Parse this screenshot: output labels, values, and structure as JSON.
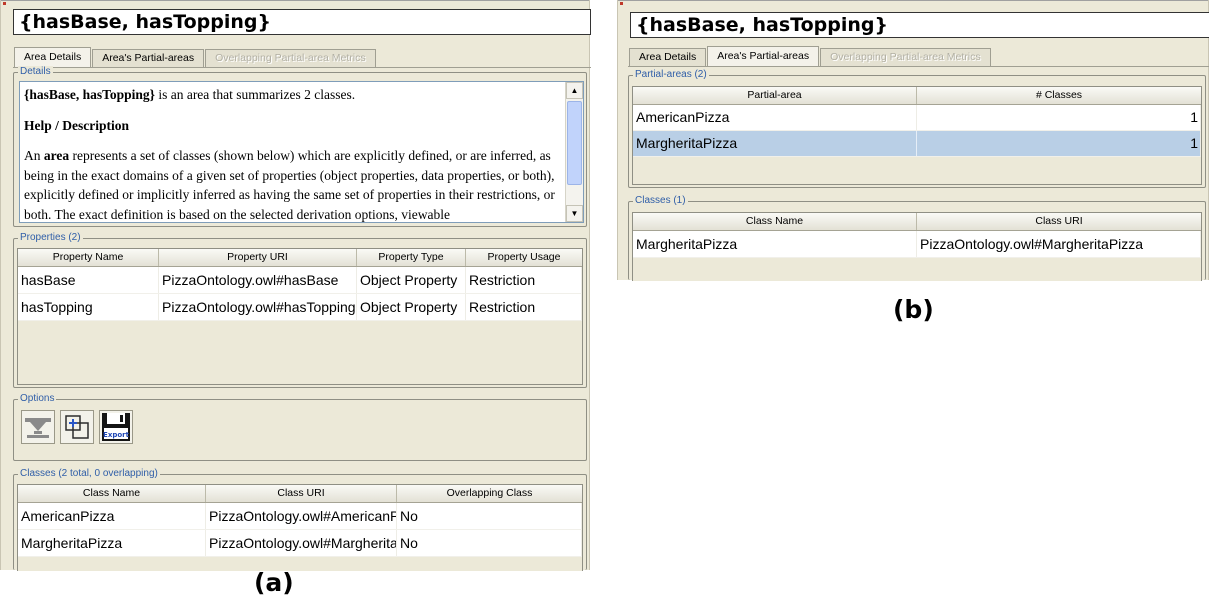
{
  "panel_a": {
    "title": "{hasBase, hasTopping}",
    "tabs": [
      {
        "label": "Area Details",
        "state": "active"
      },
      {
        "label": "Area's Partial-areas",
        "state": "normal"
      },
      {
        "label": "Overlapping Partial-area Metrics",
        "state": "disabled"
      }
    ],
    "details": {
      "group_title": "Details",
      "summary_name": "{hasBase, hasTopping}",
      "summary_rest": " is an area that summarizes 2 classes.",
      "help_heading": "Help / Description",
      "desc_prefix": "An ",
      "desc_bold": "area",
      "desc_rest": " represents a set of classes (shown below) which are explicitly defined, or are inferred, as being in the exact domains of a given set of properties (object properties, data properties, or both), explicitly defined or implicitly inferred as having the same set of properties in their restrictions, or both. The exact definition is based on the selected derivation options, viewable"
    },
    "properties": {
      "group_title": "Properties (2)",
      "columns": [
        "Property Name",
        "Property URI",
        "Property Type",
        "Property Usage"
      ],
      "rows": [
        [
          "hasBase",
          "PizzaOntology.owl#hasBase",
          "Object Property",
          "Restriction"
        ],
        [
          "hasTopping",
          "PizzaOntology.owl#hasTopping",
          "Object Property",
          "Restriction"
        ]
      ]
    },
    "options": {
      "group_title": "Options",
      "export_label": "Export"
    },
    "classes": {
      "group_title": "Classes (2 total, 0 overlapping)",
      "columns": [
        "Class Name",
        "Class URI",
        "Overlapping Class"
      ],
      "rows": [
        [
          "AmericanPizza",
          "PizzaOntology.owl#AmericanP",
          "No"
        ],
        [
          "MargheritaPizza",
          "PizzaOntology.owl#Margherita",
          "No"
        ]
      ]
    },
    "caption": "(a)"
  },
  "panel_b": {
    "title": "{hasBase, hasTopping}",
    "tabs": [
      {
        "label": "Area Details",
        "state": "normal"
      },
      {
        "label": "Area's Partial-areas",
        "state": "active"
      },
      {
        "label": "Overlapping Partial-area Metrics",
        "state": "disabled"
      }
    ],
    "partial_areas": {
      "group_title": "Partial-areas (2)",
      "columns": [
        "Partial-area",
        "# Classes"
      ],
      "rows": [
        [
          "AmericanPizza",
          "1"
        ],
        [
          "MargheritaPizza",
          "1"
        ]
      ],
      "selected_row": 1
    },
    "classes": {
      "group_title": "Classes (1)",
      "columns": [
        "Class Name",
        "Class URI"
      ],
      "rows": [
        [
          "MargheritaPizza",
          "PizzaOntology.owl#MargheritaPizza"
        ]
      ]
    },
    "caption": "(b)"
  },
  "colors": {
    "panel_bg": "#ece9d8",
    "group_title": "#2f5ea8",
    "selected_row": "#b9cfe6",
    "scroll_thumb": "#c1d3fb"
  }
}
